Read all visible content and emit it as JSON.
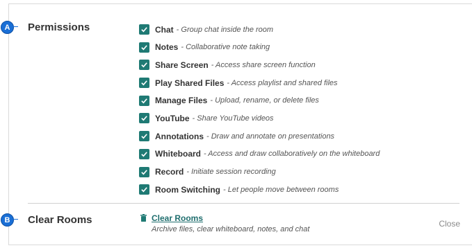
{
  "badges": {
    "a": "A",
    "b": "B"
  },
  "permissions": {
    "heading": "Permissions",
    "items": [
      {
        "name": "Chat",
        "desc": "- Group chat inside the room",
        "checked": true
      },
      {
        "name": "Notes",
        "desc": "- Collaborative note taking",
        "checked": true
      },
      {
        "name": "Share Screen",
        "desc": "- Access share screen function",
        "checked": true
      },
      {
        "name": "Play Shared Files",
        "desc": "- Access playlist and shared files",
        "checked": true
      },
      {
        "name": "Manage Files",
        "desc": "- Upload, rename, or delete files",
        "checked": true
      },
      {
        "name": "YouTube",
        "desc": "- Share YouTube videos",
        "checked": true
      },
      {
        "name": "Annotations",
        "desc": "- Draw and annotate on presentations",
        "checked": true
      },
      {
        "name": "Whiteboard",
        "desc": "- Access and draw collaboratively on the whiteboard",
        "checked": true
      },
      {
        "name": "Record",
        "desc": "- Initiate session recording",
        "checked": true
      },
      {
        "name": "Room Switching",
        "desc": "- Let people move between rooms",
        "checked": true
      }
    ]
  },
  "clear_rooms": {
    "heading": "Clear Rooms",
    "link_label": "Clear Rooms",
    "description": "Archive files, clear whiteboard, notes, and chat",
    "icon": "trash-icon"
  },
  "close_label": "Close",
  "colors": {
    "checkbox": "#1f7a74",
    "link": "#1f6e6e",
    "badge": "#1a6fd6"
  }
}
